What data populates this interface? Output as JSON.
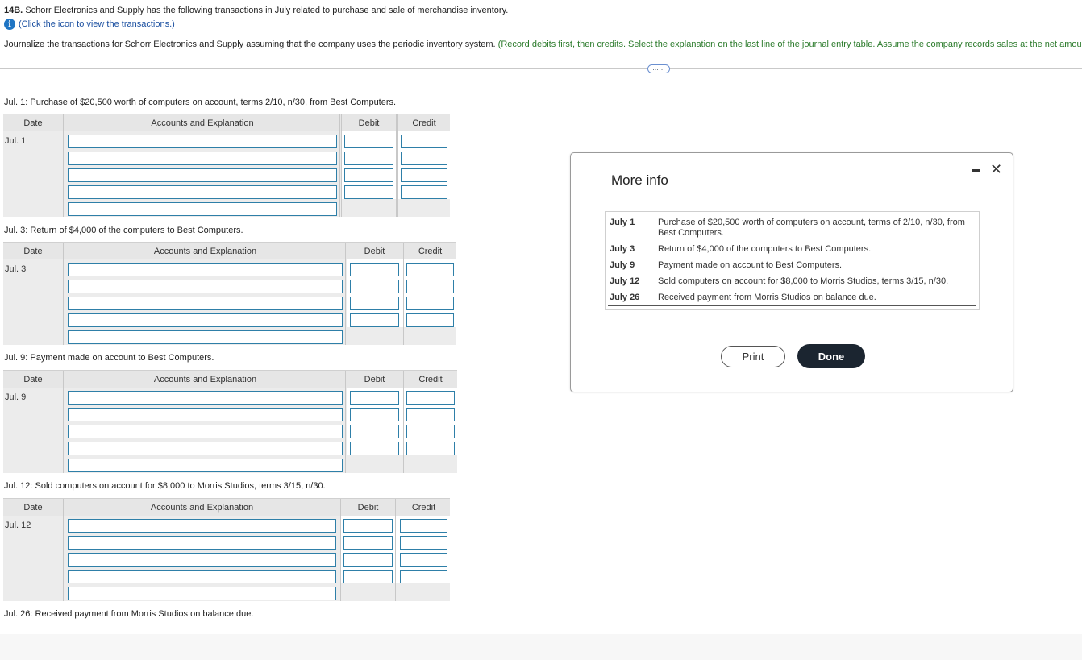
{
  "header": {
    "problem_number": "14B.",
    "problem_text": "Schorr Electronics and Supply has the following transactions in July related to purchase and sale of merchandise inventory.",
    "info_link": "(Click the icon to view the transactions.)",
    "instruction_main": "Journalize the transactions for Schorr Electronics and Supply assuming that the company uses the periodic inventory system.",
    "instruction_green": "(Record debits first, then credits. Select the explanation on the last line of the journal entry table. Assume the company records sales at the net amount.)",
    "more_button": "……"
  },
  "columns": {
    "date": "Date",
    "accounts": "Accounts and Explanation",
    "debit": "Debit",
    "credit": "Credit"
  },
  "entries": [
    {
      "label": "Jul. 1: Purchase of $20,500 worth of computers on account, terms 2/10, n/30, from Best Computers.",
      "date": "Jul. 1"
    },
    {
      "label": "Jul. 3: Return of $4,000 of the computers to Best Computers.",
      "date": "Jul. 3"
    },
    {
      "label": "Jul. 9: Payment made on account to Best Computers.",
      "date": "Jul. 9"
    },
    {
      "label": "Jul. 12: Sold computers on account for $8,000 to Morris Studios, terms 3/15, n/30.",
      "date": "Jul. 12"
    },
    {
      "label": "Jul. 26: Received payment from Morris Studios on balance due."
    }
  ],
  "modal": {
    "title": "More info",
    "rows": [
      {
        "date": "July 1",
        "text": "Purchase of $20,500 worth of computers on account, terms of 2/10, n/30, from Best Computers."
      },
      {
        "date": "July 3",
        "text": "Return of $4,000 of the computers to Best Computers."
      },
      {
        "date": "July 9",
        "text": "Payment made on account to Best Computers."
      },
      {
        "date": "July 12",
        "text": "Sold computers on account for $8,000 to Morris Studios, terms 3/15, n/30."
      },
      {
        "date": "July 26",
        "text": "Received payment from Morris Studios on balance due."
      }
    ],
    "print_label": "Print",
    "done_label": "Done",
    "close_glyph": "✕"
  }
}
